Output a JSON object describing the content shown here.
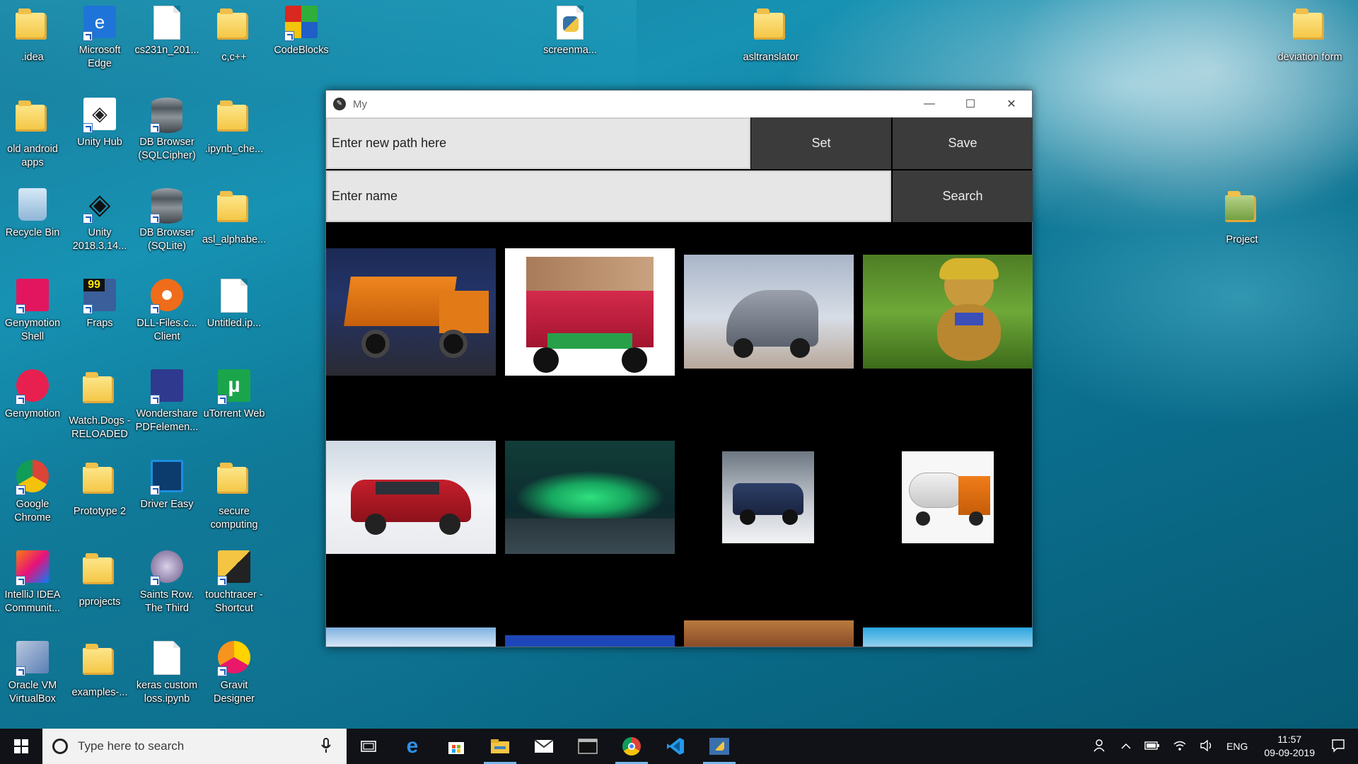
{
  "desktop_icons": [
    {
      "label": ".idea"
    },
    {
      "label": "Microsoft Edge"
    },
    {
      "label": "cs231n_201..."
    },
    {
      "label": "c,c++"
    },
    {
      "label": "CodeBlocks"
    },
    {
      "label": "screenma..."
    },
    {
      "label": "asltranslator"
    },
    {
      "label": "deviation form"
    },
    {
      "label": "old android apps"
    },
    {
      "label": "Unity Hub"
    },
    {
      "label": "DB Browser (SQLCipher)"
    },
    {
      "label": ".ipynb_che..."
    },
    {
      "label": "Recycle Bin"
    },
    {
      "label": "Unity 2018.3.14..."
    },
    {
      "label": "DB Browser (SQLite)"
    },
    {
      "label": "asl_alphabe..."
    },
    {
      "label": "Project"
    },
    {
      "label": "Genymotion Shell"
    },
    {
      "label": "Fraps"
    },
    {
      "label": "DLL-Files.c... Client"
    },
    {
      "label": "Untitled.ip..."
    },
    {
      "label": "Genymotion"
    },
    {
      "label": "Watch.Dogs - RELOADED"
    },
    {
      "label": "Wondershare PDFelemen..."
    },
    {
      "label": "uTorrent Web"
    },
    {
      "label": "Google Chrome"
    },
    {
      "label": "Prototype 2"
    },
    {
      "label": "Driver Easy"
    },
    {
      "label": "secure computing"
    },
    {
      "label": "IntelliJ IDEA Communit..."
    },
    {
      "label": "pprojects"
    },
    {
      "label": "Saints Row. The Third"
    },
    {
      "label": "touchtracer - Shortcut"
    },
    {
      "label": "Oracle VM VirtualBox"
    },
    {
      "label": "examples-..."
    },
    {
      "label": "keras custom loss.ipynb"
    },
    {
      "label": "Gravit Designer"
    }
  ],
  "window": {
    "title": "My",
    "path_input": {
      "placeholder": "Enter new path here",
      "value": ""
    },
    "set_label": "Set",
    "save_label": "Save",
    "name_input": {
      "placeholder": "Enter name",
      "value": ""
    },
    "search_label": "Search",
    "thumbnails": [
      {
        "name": "orange-dump-truck"
      },
      {
        "name": "red-indian-truck"
      },
      {
        "name": "silver-semi-truck"
      },
      {
        "name": "teddy-bear-on-grass"
      },
      {
        "name": "red-suv"
      },
      {
        "name": "northern-lights"
      },
      {
        "name": "pickup-truck-snow"
      },
      {
        "name": "orange-tanker-truck"
      },
      {
        "name": "partial-image-1"
      },
      {
        "name": "partial-image-2"
      },
      {
        "name": "partial-image-3"
      },
      {
        "name": "partial-image-4"
      }
    ]
  },
  "taskbar": {
    "search_placeholder": "Type here to search",
    "language": "ENG",
    "time": "11:57",
    "date": "09-09-2019"
  },
  "colors": {
    "window_bg": "#000000",
    "button_bg": "#3b3b3b",
    "input_bg": "#e6e6e6",
    "taskbar_bg": "#101217",
    "accent": "#76b9ed"
  }
}
